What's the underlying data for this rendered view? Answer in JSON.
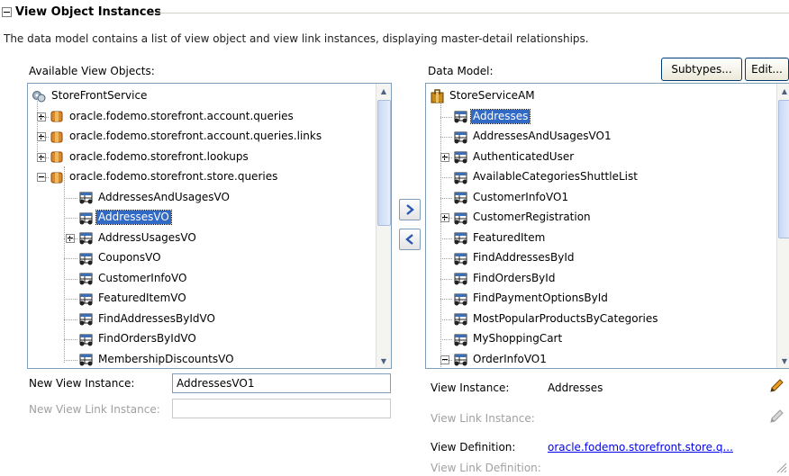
{
  "section": {
    "title": "View Object Instances",
    "description": "The data model contains a list of view object and view link instances, displaying master-detail relationships."
  },
  "available": {
    "label": "Available View Objects:",
    "root": "StoreFrontService",
    "packages": [
      "oracle.fodemo.storefront.account.queries",
      "oracle.fodemo.storefront.account.queries.links",
      "oracle.fodemo.storefront.lookups",
      "oracle.fodemo.storefront.store.queries"
    ],
    "items": [
      "AddressesAndUsagesVO",
      "AddressesVO",
      "AddressUsagesVO",
      "CouponsVO",
      "CustomerInfoVO",
      "FeaturedItemVO",
      "FindAddressesByIdVO",
      "FindOrdersByIdVO",
      "MembershipDiscountsVO"
    ],
    "selected_index": 1
  },
  "data_model": {
    "label": "Data Model:",
    "subtypes_button": "Subtypes...",
    "edit_button": "Edit...",
    "root": "StoreServiceAM",
    "items": [
      "Addresses",
      "AddressesAndUsagesVO1",
      "AuthenticatedUser",
      "AvailableCategoriesShuttleList",
      "CustomerInfoVO1",
      "CustomerRegistration",
      "FeaturedItem",
      "FindAddressesById",
      "FindOrdersById",
      "FindPaymentOptionsById",
      "MostPopularProductsByCategories",
      "MyShoppingCart",
      "OrderInfoVO1"
    ],
    "selected_index": 0
  },
  "form": {
    "new_view_instance_label": "New View Instance:",
    "new_view_instance_value": "AddressesVO1",
    "new_view_link_instance_label": "New View Link Instance:",
    "new_view_link_instance_value": ""
  },
  "details": {
    "view_instance_label": "View Instance:",
    "view_instance_value": "Addresses",
    "view_link_instance_label": "View Link Instance:",
    "view_definition_label": "View Definition:",
    "view_definition_value": "oracle.fodemo.storefront.store.q...",
    "view_link_definition_label": "View Link Definition:"
  },
  "icons": {
    "root": "service-icon",
    "package": "package-icon",
    "view_object": "view-object-icon",
    "app_module": "application-module-icon",
    "edit": "pencil-icon",
    "shuttle_right": "shuttle-right-icon",
    "shuttle_left": "shuttle-left-icon"
  },
  "colors": {
    "selection": "#316ac5",
    "link": "#0000ee",
    "border": "#7f9db9"
  }
}
